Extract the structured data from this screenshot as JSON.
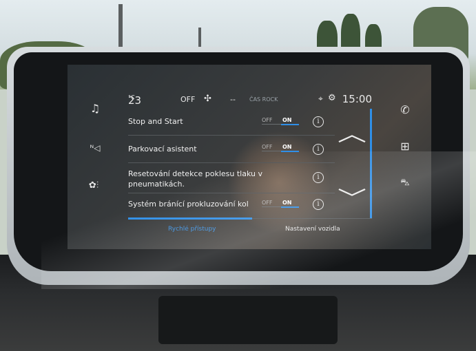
{
  "status_bar": {
    "temperature": "23",
    "temperature_unit": "°C",
    "fan_state": "OFF",
    "fan_icon": "fan-icon",
    "separator": "--",
    "radio_station": "ČAS ROCK",
    "clock": "15:00"
  },
  "left_icons": [
    "music-icon",
    "navigation-icon",
    "climate-icon"
  ],
  "right_icons": [
    "phone-icon",
    "apps-grid-icon",
    "car-icon"
  ],
  "settings_rows": [
    {
      "label": "Stop and Start",
      "off": "OFF",
      "on": "ON"
    },
    {
      "label": "Parkovací asistent",
      "off": "OFF",
      "on": "ON"
    },
    {
      "label": "Resetování detekce poklesu tlaku v pneumatikách.",
      "off": "",
      "on": ""
    },
    {
      "label": "Systém bránící prokluzování kol",
      "off": "OFF",
      "on": "ON"
    }
  ],
  "info_symbol": "i",
  "tabs": {
    "quick_access": "Rychlé přístupy",
    "vehicle_settings": "Nastavení vozidla"
  },
  "scroll": {
    "up_icon": "chevron-up-icon",
    "down_icon": "chevron-down-icon"
  },
  "colors": {
    "accent": "#2f8fe8",
    "text": "#f0f0f0",
    "screen_bg": "#2f3437"
  }
}
